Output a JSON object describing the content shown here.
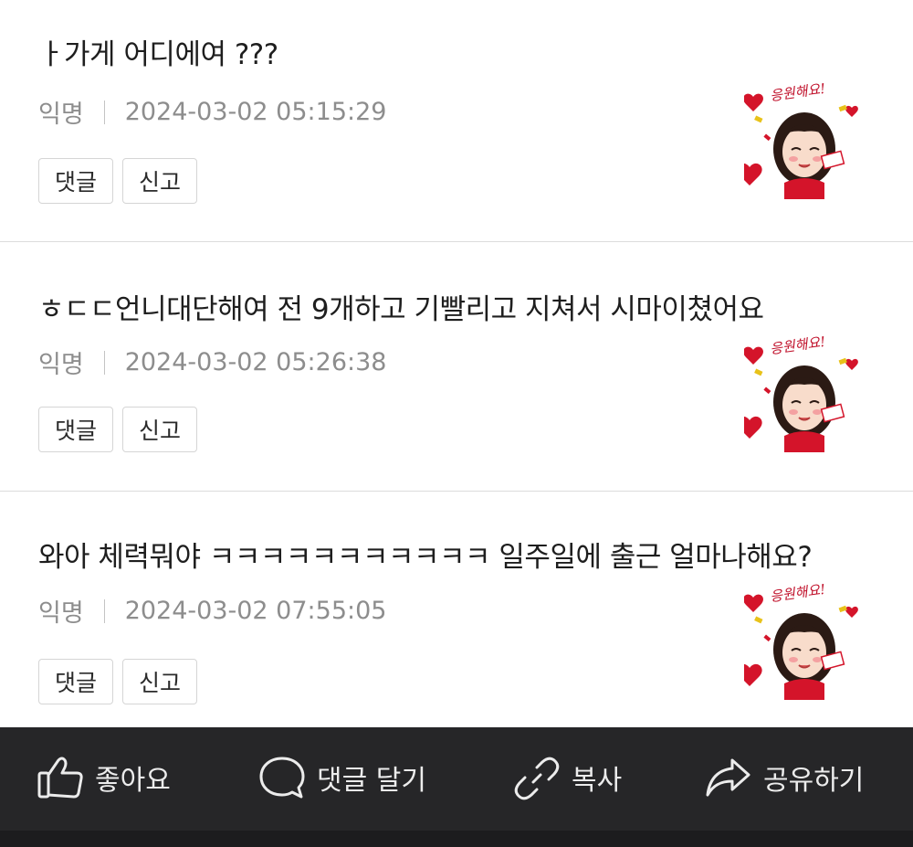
{
  "comments": [
    {
      "text": "ㅏ가게 어디에여 ???",
      "author": "익명",
      "timestamp": "2024-03-02 05:15:29",
      "reply_label": "댓글",
      "report_label": "신고",
      "sticker_caption": "응원해요!"
    },
    {
      "text": "ㅎㄷㄷ언니대단해여 전 9개하고 기빨리고 지쳐서 시마이쳤어요",
      "author": "익명",
      "timestamp": "2024-03-02 05:26:38",
      "reply_label": "댓글",
      "report_label": "신고",
      "sticker_caption": "응원해요!"
    },
    {
      "text": "와아 체력뭐야 ㅋㅋㅋㅋㅋㅋㅋㅋㅋㅋㅋ 일주일에 출근 얼마나해요?",
      "author": "익명",
      "timestamp": "2024-03-02 07:55:05",
      "reply_label": "댓글",
      "report_label": "신고",
      "sticker_caption": "응원해요!"
    }
  ],
  "bottom_bar": {
    "like_label": "좋아요",
    "comment_label": "댓글 달기",
    "copy_label": "복사",
    "share_label": "공유하기"
  },
  "colors": {
    "bar_background": "#262628",
    "meta_text": "#8d8d8d",
    "sticker_red": "#d4142a"
  }
}
